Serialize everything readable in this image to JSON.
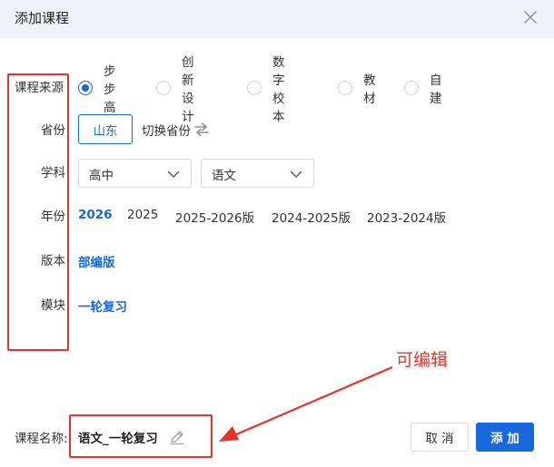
{
  "dialog": {
    "title": "添加课程",
    "close_icon": "close-icon"
  },
  "form": {
    "source": {
      "label": "课程来源",
      "options": [
        {
          "label": "步步高",
          "selected": true
        },
        {
          "label": "创新设计",
          "selected": false
        },
        {
          "label": "数字校本",
          "selected": false
        },
        {
          "label": "教材",
          "selected": false
        },
        {
          "label": "自建",
          "selected": false
        }
      ]
    },
    "province": {
      "label": "省份",
      "value": "山东",
      "switch_label": "切换省份",
      "switch_icon": "swap-icon"
    },
    "subject": {
      "label": "学科",
      "stage": "高中",
      "subject": "语文"
    },
    "year": {
      "label": "年份",
      "options": [
        {
          "label": "2026",
          "selected": true
        },
        {
          "label": "2025",
          "selected": false
        },
        {
          "label": "2025-2026版",
          "selected": false
        },
        {
          "label": "2024-2025版",
          "selected": false
        },
        {
          "label": "2023-2024版",
          "selected": false
        }
      ]
    },
    "edition": {
      "label": "版本",
      "value": "部编版"
    },
    "module": {
      "label": "模块",
      "value": "一轮复习"
    }
  },
  "footer": {
    "name_label": "课程名称:",
    "name_value": "语文_一轮复习",
    "edit_icon": "edit-icon",
    "cancel_label": "取 消",
    "add_label": "添 加"
  },
  "annotation": {
    "text": "可编辑",
    "color": "#e8322a"
  },
  "colors": {
    "accent": "#1668dc",
    "header_bg": "#eef3fb"
  }
}
